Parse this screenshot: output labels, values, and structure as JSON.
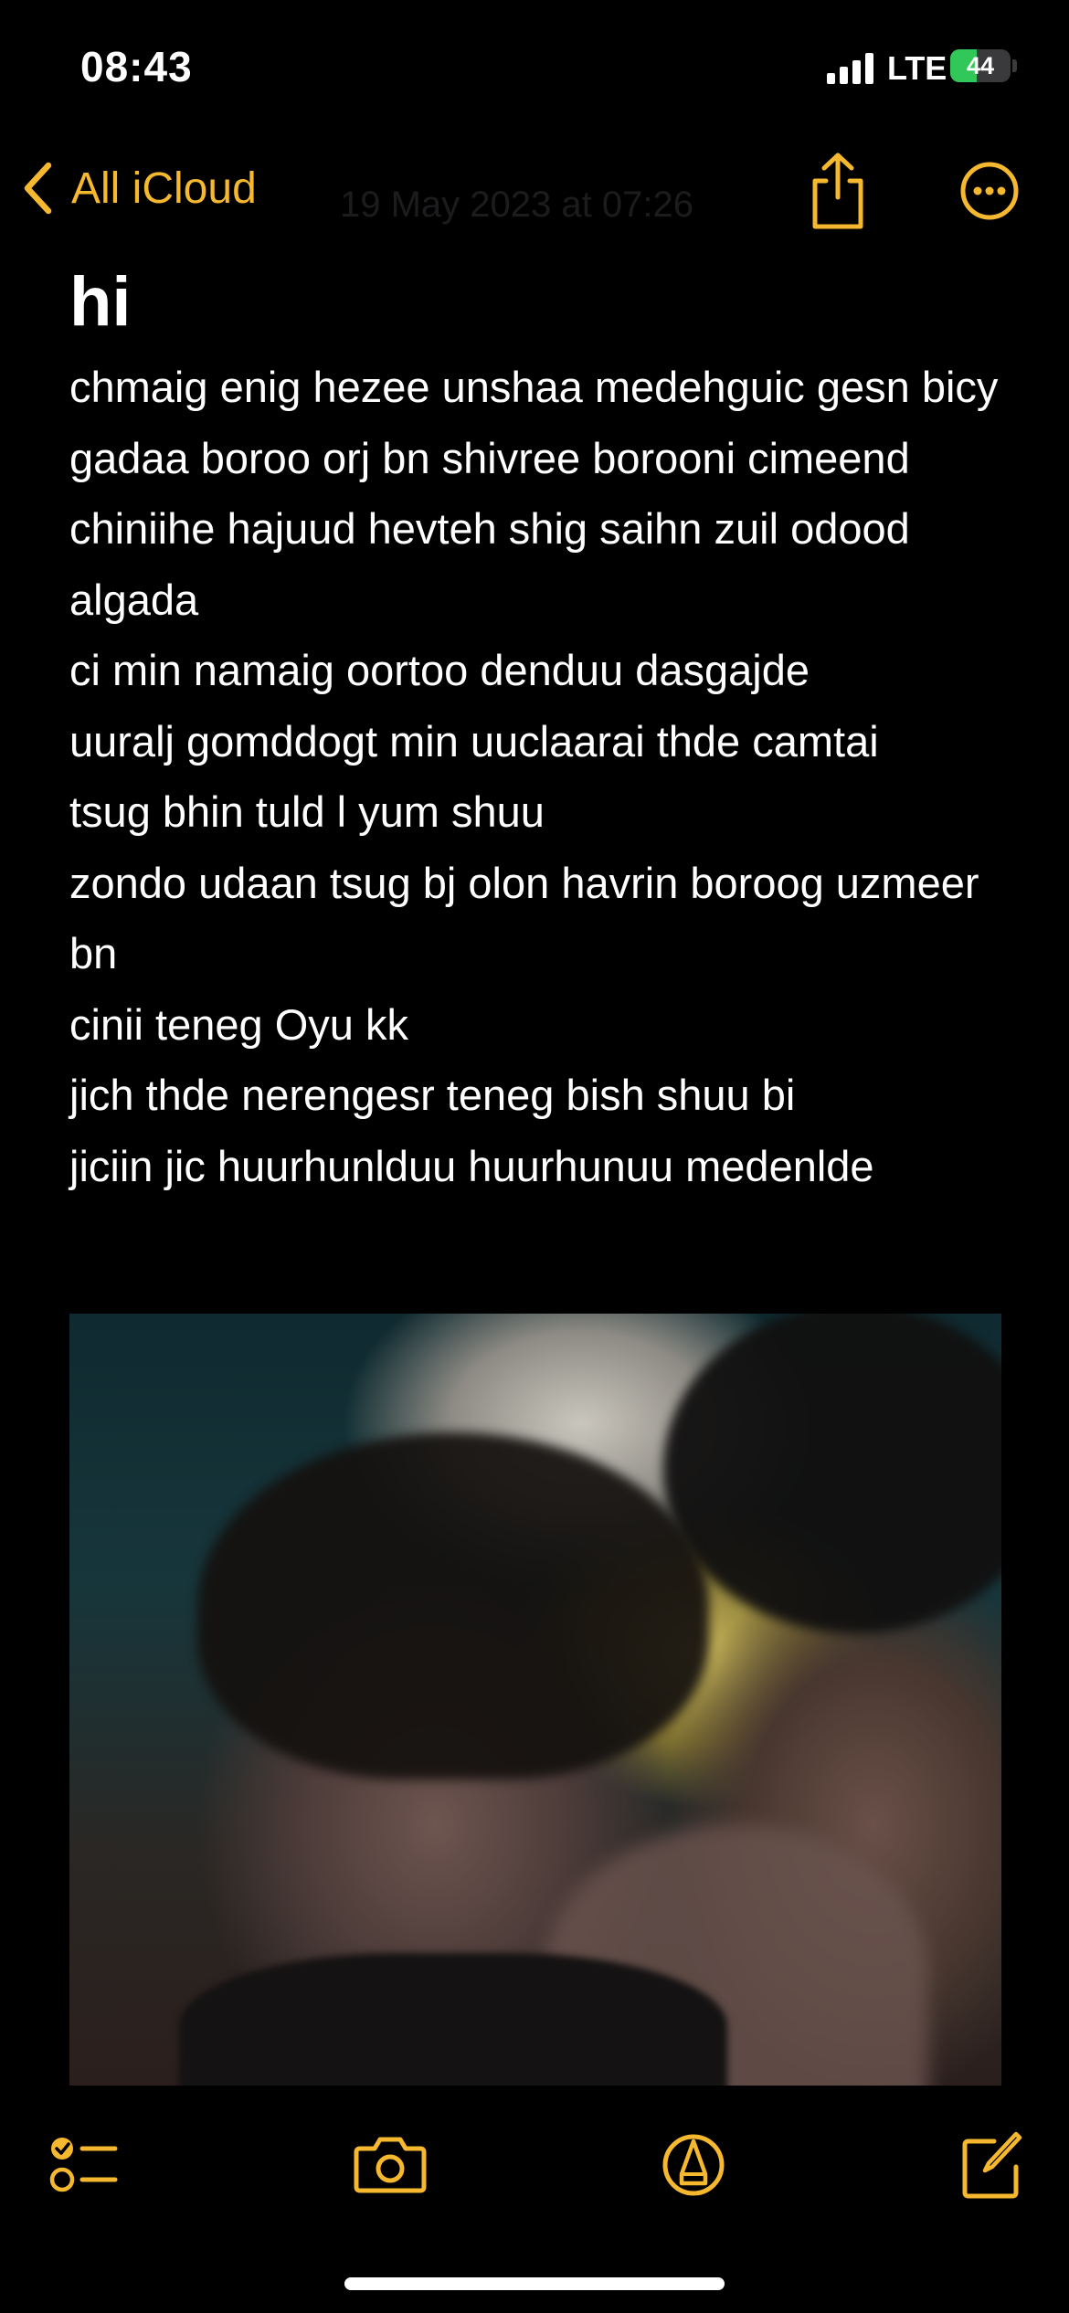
{
  "status_bar": {
    "time": "08:43",
    "network": "LTE",
    "battery_level": "44",
    "battery_fraction": 0.44,
    "battery_color": "#32c759"
  },
  "nav": {
    "back_label": "All iCloud",
    "faded_date": "19 May 2023 at 07:26",
    "share_icon": "share-icon",
    "more_icon": "ellipsis-circle-icon",
    "accent_color": "#f5b82e"
  },
  "note": {
    "title": "hi",
    "lines": [
      "chmaig enig hezee unshaa medehguic gesn bicy",
      "gadaa boroo orj bn shivree borooni cimeend",
      "chiniihe hajuud hevteh shig saihn zuil odood algada",
      "ci min namaig oortoo denduu dasgajde",
      "uuralj gomddogt min uuclaarai thde camtai",
      "tsug bhin tuld l yum shuu",
      "zondo udaan tsug bj olon havrin boroog uzmeer bn",
      "cinii teneg Oyu kk",
      "jich thde nerengesr teneg bish shuu bi",
      "jiciin jic huurhunlduu huurhunuu medenlde"
    ],
    "photo": "photo"
  },
  "toolbar": {
    "checklist_icon": "checklist-icon",
    "camera_icon": "camera-icon",
    "markup_icon": "markup-pen-icon",
    "compose_icon": "compose-icon"
  }
}
